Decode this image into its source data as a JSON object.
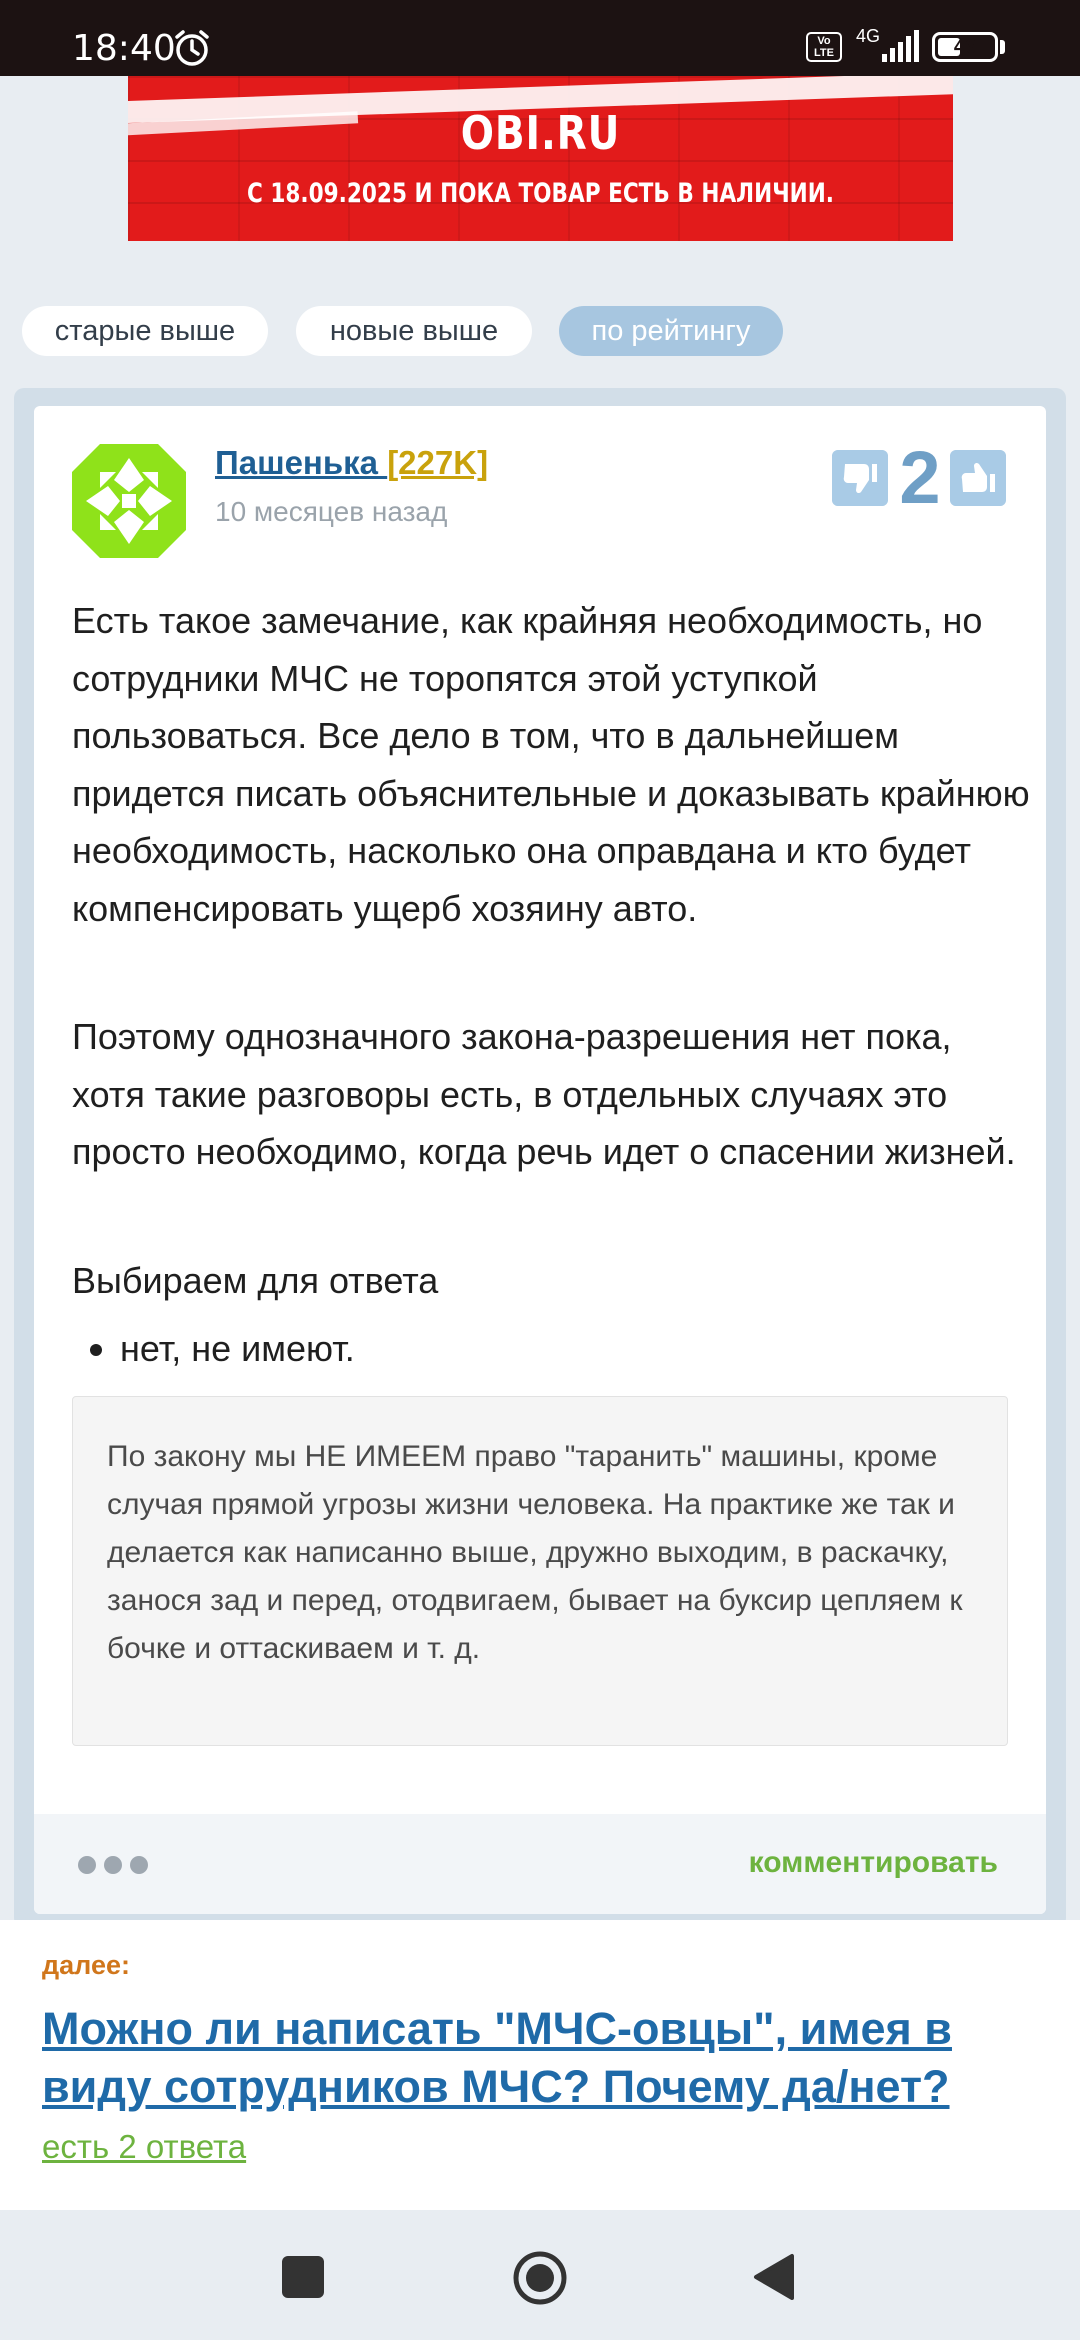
{
  "status": {
    "time": "18:40",
    "network": "4G",
    "volte": "Vo\nLTE",
    "battery": "46",
    "battery_level_percent": 46
  },
  "ad": {
    "site": "OBI.RU",
    "promo": "С 18.09.2025 И ПОКА ТОВАР ЕСТЬ В НАЛИЧИИ."
  },
  "sort": {
    "old_first": "старые выше",
    "new_first": "новые выше",
    "by_rating": "по рейтингу"
  },
  "answer": {
    "author_name": "Пашенька ",
    "author_rank": "[227K]",
    "time_ago": "10 месяцев назад",
    "votes": "2",
    "paragraph1": "Есть такое замечание, как крайняя необходимость, но сотрудники МЧС не торопятся этой уступкой пользоваться. Все дело в том, что в дальнейшем придется писать объяснительные и доказывать крайнюю необходимость, насколько она оправдана и кто будет компенсировать ущерб хозяину авто.",
    "paragraph2": "Поэтому однозначного закона-разрешения нет пока, хотя такие разговоры есть, в отдельных случаях это просто необходимо, когда речь идет о спасении жизней.",
    "paragraph3": "Выбираем для ответа",
    "bullet1": "нет, не имеют.",
    "quote": "По закону мы НЕ ИМЕЕМ право \"таранить\" машины, кроме случая прямой угрозы жизни человека. На практике же так и делается как написанно выше, дружно выходим, в раскачку, занося зад и перед, отодвигаем, бывает на буксир цепляем к бочке и оттаскиваем и т. д.",
    "comment_label": "комментировать"
  },
  "next": {
    "label": "далее:",
    "title": "Можно ли написать \"МЧС-овцы\", имея в виду сотрудников МЧС? Почему да/нет?",
    "answers": "есть 2 ответа"
  },
  "colors": {
    "link_blue": "#1f6aa8",
    "accent_green": "#6db33f",
    "rank_gold": "#c9a20c",
    "next_label_orange": "#d0761b",
    "pill_active": "#a7c6e0"
  },
  "icons": {
    "status": [
      "alarm-icon",
      "volte-icon",
      "signal-icon",
      "battery-icon"
    ],
    "vote": [
      "thumbs-down-icon",
      "thumbs-up-icon"
    ],
    "nav": [
      "recents-square-icon",
      "home-circle-icon",
      "back-triangle-icon"
    ]
  }
}
